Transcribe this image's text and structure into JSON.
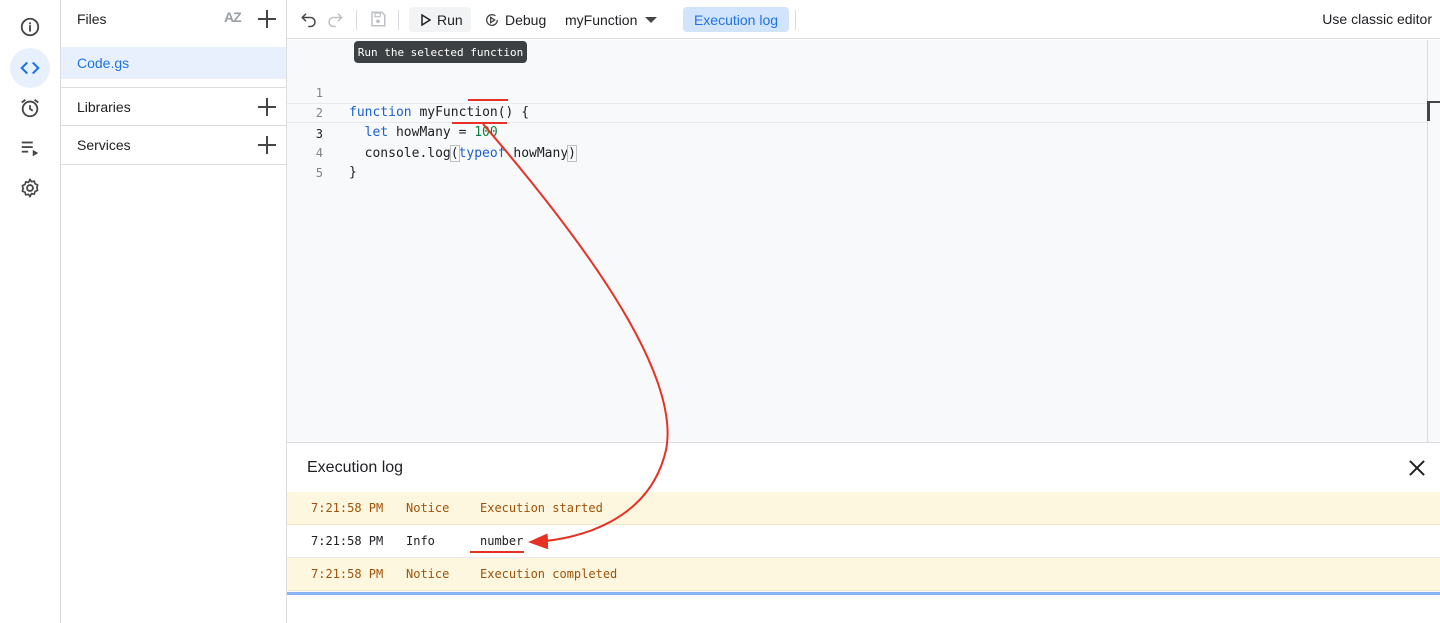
{
  "files_panel": {
    "title": "Files",
    "sort_icon": "AZ",
    "file_name": "Code.gs",
    "libraries_label": "Libraries",
    "services_label": "Services"
  },
  "toolbar": {
    "run_label": "Run",
    "debug_label": "Debug",
    "function_name": "myFunction",
    "execution_log_label": "Execution log",
    "classic_editor_label": "Use classic editor",
    "run_tooltip": "Run the selected function"
  },
  "editor": {
    "line_numbers": [
      "1",
      "2",
      "3",
      "4",
      "5"
    ],
    "line1": {
      "kw": "function",
      "rest": " myFunction() {"
    },
    "line2": {
      "indent": "  ",
      "kw": "let",
      "mid": " howMany = ",
      "num": "100"
    },
    "line3": {
      "indent": "  ",
      "pre": "console.log",
      "open": "(",
      "kw": "typeof",
      "mid": " howMany",
      "close": ")"
    },
    "line4": {
      "text": "}"
    }
  },
  "log": {
    "title": "Execution log",
    "rows": [
      {
        "time": "7:21:58 PM",
        "level": "Notice",
        "message": "Execution started"
      },
      {
        "time": "7:21:58 PM",
        "level": "Info",
        "message": "number"
      },
      {
        "time": "7:21:58 PM",
        "level": "Notice",
        "message": "Execution completed"
      }
    ]
  },
  "icons": {
    "rail": [
      "info-icon",
      "code-icon",
      "triggers-clock-icon",
      "executions-icon",
      "settings-gear-icon"
    ],
    "toolbar": [
      "undo-icon",
      "redo-icon",
      "save-icon",
      "play-icon",
      "debug-icon",
      "chevron-down-icon"
    ]
  },
  "colors": {
    "accent": "#1a73e8",
    "keyword": "#1a5fd0",
    "number": "#0b8043",
    "notice_bg": "#fef7e0",
    "notice_text": "#a0520a",
    "annotation_red": "#e53224"
  }
}
